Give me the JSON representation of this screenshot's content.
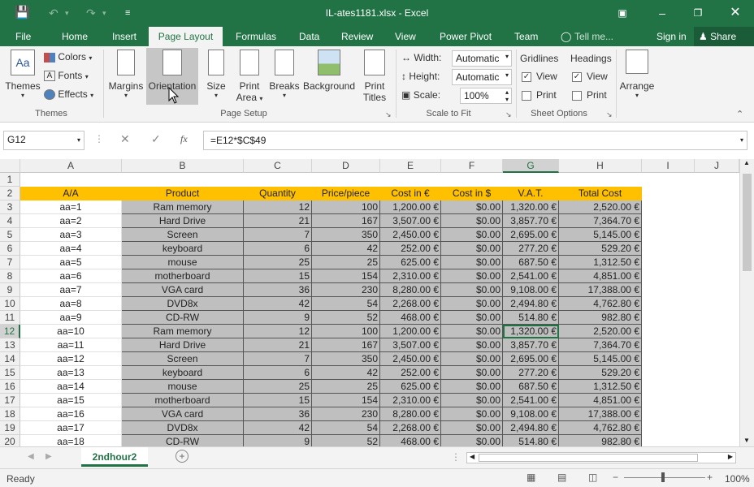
{
  "window": {
    "title": "IL-ates1181.xlsx - Excel",
    "sign_in": "Sign in",
    "share": "Share",
    "tell_me": "Tell me..."
  },
  "tabs": [
    "File",
    "Home",
    "Insert",
    "Page Layout",
    "Formulas",
    "Data",
    "Review",
    "View",
    "Power Pivot",
    "Team"
  ],
  "ribbon": {
    "themes": {
      "themes_label": "Themes",
      "colors": "Colors",
      "fonts": "Fonts",
      "effects": "Effects",
      "group": "Themes"
    },
    "page_setup": {
      "margins": "Margins",
      "orientation": "Orientation",
      "size": "Size",
      "print_area_1": "Print",
      "print_area_2": "Area",
      "breaks": "Breaks",
      "background": "Background",
      "print_titles_1": "Print",
      "print_titles_2": "Titles",
      "group": "Page Setup"
    },
    "scale": {
      "width_label": "Width:",
      "width_val": "Automatic",
      "height_label": "Height:",
      "height_val": "Automatic",
      "scale_label": "Scale:",
      "scale_val": "100%",
      "group": "Scale to Fit"
    },
    "sheet_options": {
      "gridlines": "Gridlines",
      "headings": "Headings",
      "view": "View",
      "print": "Print",
      "group": "Sheet Options"
    },
    "arrange": "Arrange"
  },
  "formula_bar": {
    "name_box": "G12",
    "formula": "=E12*$C$49",
    "fx": "fx"
  },
  "columns": [
    "A",
    "B",
    "C",
    "D",
    "E",
    "F",
    "G",
    "H",
    "I",
    "J"
  ],
  "header_row": [
    "A/A",
    "Product",
    "Quantity",
    "Price/piece",
    "Cost in €",
    "Cost in $",
    "V.A.T.",
    "Total Cost"
  ],
  "rows": [
    [
      "aa=1",
      "Ram memory",
      "12",
      "100",
      "1,200.00 €",
      "$0.00",
      "1,320.00 €",
      "2,520.00 €"
    ],
    [
      "aa=2",
      "Hard Drive",
      "21",
      "167",
      "3,507.00 €",
      "$0.00",
      "3,857.70 €",
      "7,364.70 €"
    ],
    [
      "aa=3",
      "Screen",
      "7",
      "350",
      "2,450.00 €",
      "$0.00",
      "2,695.00 €",
      "5,145.00 €"
    ],
    [
      "aa=4",
      "keyboard",
      "6",
      "42",
      "252.00 €",
      "$0.00",
      "277.20 €",
      "529.20 €"
    ],
    [
      "aa=5",
      "mouse",
      "25",
      "25",
      "625.00 €",
      "$0.00",
      "687.50 €",
      "1,312.50 €"
    ],
    [
      "aa=6",
      "motherboard",
      "15",
      "154",
      "2,310.00 €",
      "$0.00",
      "2,541.00 €",
      "4,851.00 €"
    ],
    [
      "aa=7",
      "VGA card",
      "36",
      "230",
      "8,280.00 €",
      "$0.00",
      "9,108.00 €",
      "17,388.00 €"
    ],
    [
      "aa=8",
      "DVD8x",
      "42",
      "54",
      "2,268.00 €",
      "$0.00",
      "2,494.80 €",
      "4,762.80 €"
    ],
    [
      "aa=9",
      "CD-RW",
      "9",
      "52",
      "468.00 €",
      "$0.00",
      "514.80 €",
      "982.80 €"
    ],
    [
      "aa=10",
      "Ram memory",
      "12",
      "100",
      "1,200.00 €",
      "$0.00",
      "1,320.00 €",
      "2,520.00 €"
    ],
    [
      "aa=11",
      "Hard Drive",
      "21",
      "167",
      "3,507.00 €",
      "$0.00",
      "3,857.70 €",
      "7,364.70 €"
    ],
    [
      "aa=12",
      "Screen",
      "7",
      "350",
      "2,450.00 €",
      "$0.00",
      "2,695.00 €",
      "5,145.00 €"
    ],
    [
      "aa=13",
      "keyboard",
      "6",
      "42",
      "252.00 €",
      "$0.00",
      "277.20 €",
      "529.20 €"
    ],
    [
      "aa=14",
      "mouse",
      "25",
      "25",
      "625.00 €",
      "$0.00",
      "687.50 €",
      "1,312.50 €"
    ],
    [
      "aa=15",
      "motherboard",
      "15",
      "154",
      "2,310.00 €",
      "$0.00",
      "2,541.00 €",
      "4,851.00 €"
    ],
    [
      "aa=16",
      "VGA card",
      "36",
      "230",
      "8,280.00 €",
      "$0.00",
      "9,108.00 €",
      "17,388.00 €"
    ],
    [
      "aa=17",
      "DVD8x",
      "42",
      "54",
      "2,268.00 €",
      "$0.00",
      "2,494.80 €",
      "4,762.80 €"
    ],
    [
      "aa=18",
      "CD-RW",
      "9",
      "52",
      "468.00 €",
      "$0.00",
      "514.80 €",
      "982.80 €"
    ]
  ],
  "row_numbers": [
    "1",
    "2",
    "3",
    "4",
    "5",
    "6",
    "7",
    "8",
    "9",
    "10",
    "11",
    "12",
    "13",
    "14",
    "15",
    "16",
    "17",
    "18",
    "19",
    "20"
  ],
  "sheet": {
    "tab": "2ndhour2"
  },
  "status": {
    "ready": "Ready",
    "zoom": "100%"
  },
  "colors": {
    "excel_green": "#217346",
    "header_fill": "#ffc000",
    "gray_fill": "#bfbfbf"
  }
}
